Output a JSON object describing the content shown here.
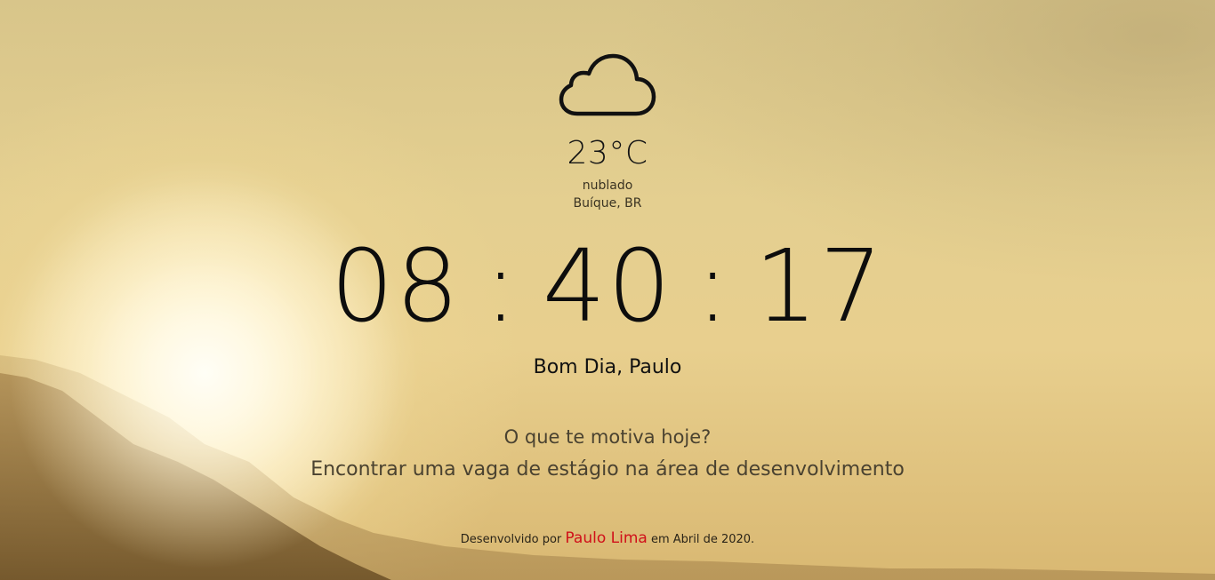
{
  "weather": {
    "icon": "cloud-icon",
    "temperature": "23°C",
    "condition": "nublado",
    "location": "Buíque, BR"
  },
  "clock": {
    "hours": "08",
    "minutes": "40",
    "seconds": "17",
    "separator": ":"
  },
  "greeting": "Bom Dia, Paulo",
  "motivation": {
    "question": "O que te motiva hoje?",
    "answer": "Encontrar uma vaga de estágio na área de desenvolvimento"
  },
  "footer": {
    "prefix": "Desenvolvido por",
    "author": "Paulo Lima",
    "suffix": "em Abril de 2020."
  },
  "colors": {
    "author_link": "#d0101a",
    "text": "#111111",
    "muted_text": "#4a4230"
  }
}
